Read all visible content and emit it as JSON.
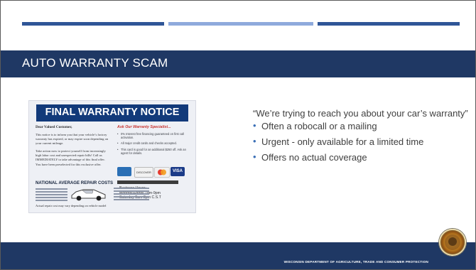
{
  "slide": {
    "title": "AUTO WARRANTY SCAM",
    "quote": "“We’re trying to reach you about your car’s warranty”",
    "bullets": [
      "Often a robocall or a mailing",
      "Urgent - only available for a limited time",
      "Offers no actual coverage"
    ],
    "footer": "WISCONSIN DEPARTMENT OF AGRICULTURE, TRADE AND CONSUMER PROTECTION",
    "accent_colors": {
      "dark_blue": "#1f3864",
      "mid_blue": "#2f5597",
      "light_blue": "#8faadc",
      "bullet_blue": "#3a6fb6"
    }
  },
  "notice": {
    "heading": "FINAL WARRANTY NOTICE",
    "greeting": "Dear Valued Customer,",
    "paragraph_1": "This notice is to inform you that your vehicle’s factory warranty has expired, or may expire soon depending on your current mileage.",
    "paragraph_2": "Take action now to protect yourself from increasingly high labor cost and unexpected repair bills! Call us IMMEDIATELY to take advantage of this final offer. You have been preselected for this exclusive offer.",
    "side_heading": "Ask Our Warranty Specialist...",
    "side_bullets": [
      "0% Interest free financing guaranteed on first call activation.",
      "All major credit cards and checks accepted.",
      "This card is good for an additional $250 off. Ask an agent for details."
    ],
    "repair_heading": "NATIONAL AVERAGE REPAIR COSTS",
    "card_brand_1": "DISCOVER",
    "card_brand_2": "VISA",
    "hours_title": "Business Hours:",
    "hours_line_1": "Monday-Friday 7am-9pm",
    "hours_line_2": "Saturday 9am-2pm C.S.T",
    "disclaimer": "Actual repair cost may vary depending on vehicle model"
  },
  "icons": {
    "seal": "state-seal-icon",
    "car": "car-icon"
  }
}
